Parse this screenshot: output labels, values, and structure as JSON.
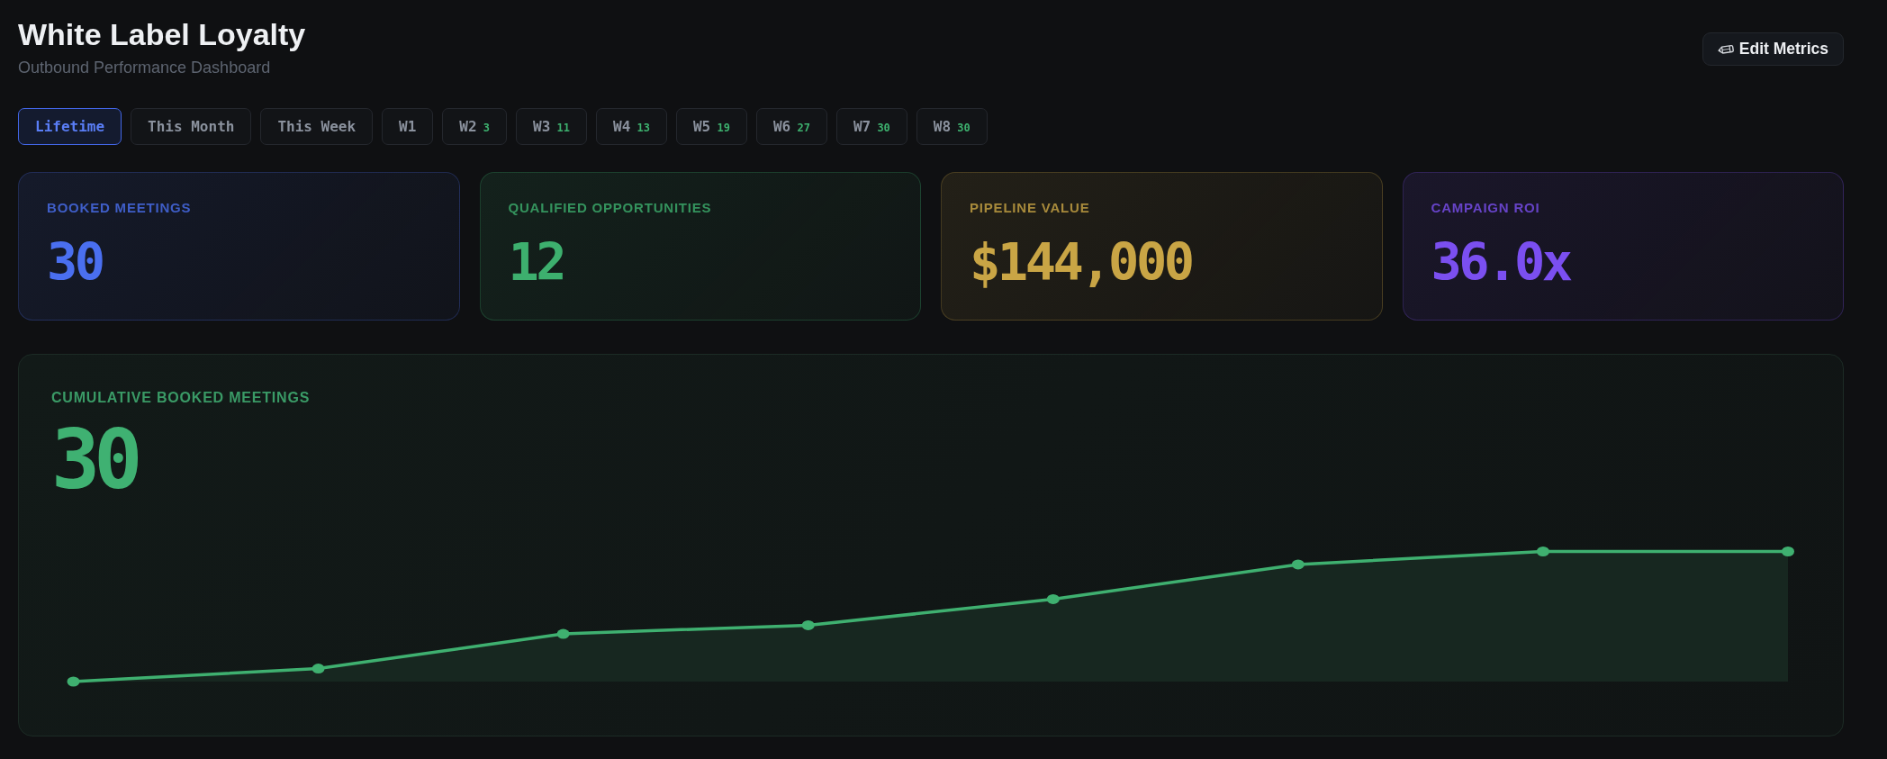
{
  "header": {
    "title": "White Label Loyalty",
    "subtitle": "Outbound Performance Dashboard",
    "edit_button": {
      "label": "Edit Metrics"
    }
  },
  "tabs": [
    {
      "label": "Lifetime",
      "selected": true
    },
    {
      "label": "This Month",
      "selected": false
    },
    {
      "label": "This Week",
      "selected": false
    },
    {
      "label": "W1",
      "selected": false
    },
    {
      "label": "W2",
      "count": "3",
      "selected": false
    },
    {
      "label": "W3",
      "count": "11",
      "selected": false
    },
    {
      "label": "W4",
      "count": "13",
      "selected": false
    },
    {
      "label": "W5",
      "count": "19",
      "selected": false
    },
    {
      "label": "W6",
      "count": "27",
      "selected": false
    },
    {
      "label": "W7",
      "count": "30",
      "selected": false
    },
    {
      "label": "W8",
      "count": "30",
      "selected": false
    }
  ],
  "metrics": [
    {
      "label": "BOOKED MEETINGS",
      "value": "30",
      "color": "#4a6ff0"
    },
    {
      "label": "QUALIFIED OPPORTUNITIES",
      "value": "12",
      "color": "#3db06e"
    },
    {
      "label": "PIPELINE VALUE",
      "value": "$144,000",
      "color": "#c9a545"
    },
    {
      "label": "CAMPAIGN ROI",
      "value": "36.0x",
      "color": "#7b4ff0"
    }
  ],
  "cumulative_panel": {
    "label": "CUMULATIVE BOOKED MEETINGS",
    "value": "30"
  }
}
